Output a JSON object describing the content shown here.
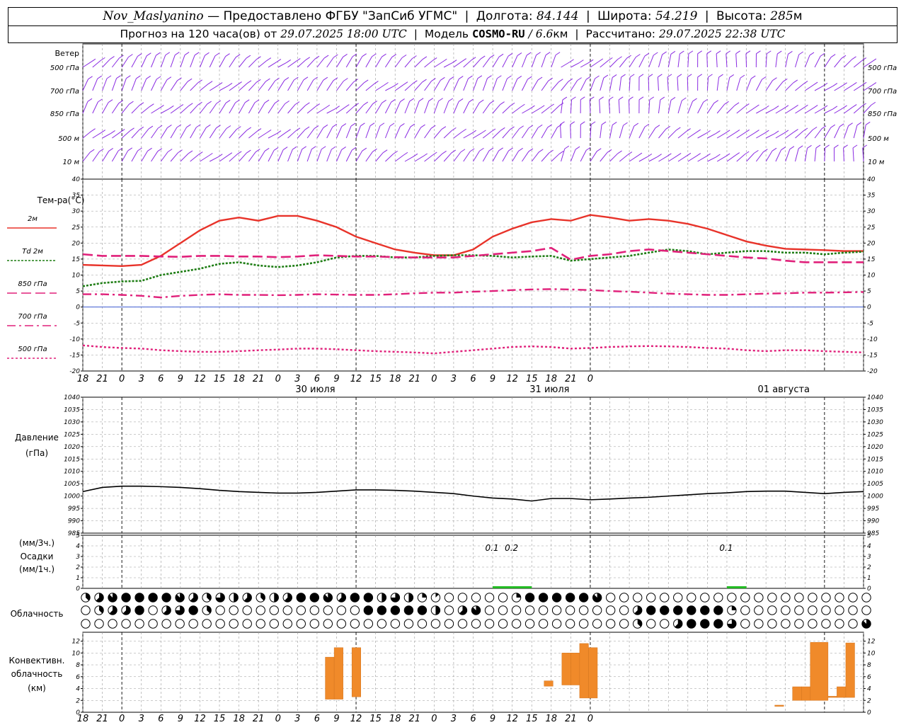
{
  "header": {
    "station": "Nov_Maslyanino",
    "provider": "— Предоставлено ФГБУ \"ЗапСиб УГМС\"",
    "lon_label": "Долгота:",
    "lon": "84.144",
    "lat_label": "Широта:",
    "lat": "54.219",
    "alt_label": "Высота:",
    "alt": "285",
    "alt_unit": "м",
    "forecast_label": "Прогноз на 120 часа(ов) от",
    "forecast_time": "29.07.2025 18:00 UTC",
    "model_label": "Модель",
    "model": "COSMO-RU",
    "resolution": "/ 6.6",
    "resolution_unit": "км",
    "calc_label": "Рассчитано:",
    "calc_time": "29.07.2025 22:38 UTC"
  },
  "colors": {
    "wind": "#8a2be2",
    "t2m": "#e8332a",
    "td2m": "#1e7d14",
    "t850": "#e0207a",
    "t700": "#e0207a",
    "t500": "#e0207a",
    "pressure": "#000000",
    "precip": "#22bb22",
    "convective": "#f08a2a",
    "grid": "#999999",
    "zero_line": "#2244cc"
  },
  "labels": {
    "wind_title": "Ветер",
    "wind_levels": [
      "500 гПа",
      "700 гПа",
      "850 гПа",
      "500 м",
      "10 м"
    ],
    "temp_title": "Тем-ра(°C)",
    "temp_legend": [
      "2м",
      "Td 2м",
      "850 гПа",
      "700 гПа",
      "500 гПа"
    ],
    "pressure_title": [
      "Давление",
      "(гПа)"
    ],
    "precip_title": [
      "(мм/3ч.)",
      "Осадки",
      "(мм/1ч.)"
    ],
    "cloud_title": "Облачность",
    "conv_title": [
      "Конвективн.",
      "облачность",
      "(км)"
    ],
    "hour_ticks": [
      "18",
      "21",
      "0",
      "3",
      "6",
      "9",
      "12",
      "15",
      "18",
      "21",
      "0",
      "3",
      "6",
      "9",
      "12",
      "15",
      "18",
      "21",
      "0",
      "3",
      "6",
      "9",
      "12",
      "15",
      "18",
      "21",
      "0"
    ],
    "dates": [
      "30 июля",
      "31 июля",
      "01 августа"
    ]
  },
  "chart_data": [
    {
      "type": "line",
      "panel": "temperature",
      "x_hours": [
        0,
        3,
        6,
        9,
        12,
        15,
        18,
        21,
        24,
        27,
        30,
        33,
        36,
        39,
        42,
        45,
        48,
        51,
        54,
        57,
        60,
        63,
        66,
        69,
        72,
        75,
        78,
        81,
        84,
        87,
        90,
        93,
        96,
        99,
        102,
        105,
        108,
        111,
        114,
        117,
        120
      ],
      "ylim": [
        -20,
        40
      ],
      "y_ticks": [
        -20,
        -15,
        -10,
        -5,
        0,
        5,
        10,
        15,
        20,
        25,
        30,
        35,
        40
      ],
      "series": [
        {
          "name": "2м",
          "values": [
            13.2,
            13,
            12.8,
            13.2,
            16,
            20,
            24,
            27,
            28,
            27,
            28.5,
            28.5,
            27,
            25,
            22,
            20,
            18,
            17,
            16.2,
            16.2,
            18,
            22,
            24.5,
            26.5,
            27.5,
            27,
            28.8,
            28,
            27,
            27.5,
            27,
            26,
            24.5,
            22.5,
            20.5,
            19.2,
            18.2,
            18,
            17.8,
            17.5,
            17.5
          ]
        },
        {
          "name": "Td 2м",
          "values": [
            6.5,
            7.5,
            8,
            8.2,
            10,
            11,
            12,
            13.5,
            14,
            13,
            12.5,
            13,
            14,
            15.5,
            16,
            16,
            15.5,
            15.5,
            16,
            16.2,
            16.2,
            16,
            15.5,
            15.8,
            16,
            14.5,
            15,
            15.5,
            16,
            17,
            18,
            17.5,
            16.5,
            17,
            17.5,
            17.5,
            17,
            17,
            16.5,
            17,
            17.3
          ]
        },
        {
          "name": "850 гПа",
          "values": [
            16.5,
            16,
            16,
            16,
            15.8,
            15.7,
            16,
            16,
            15.8,
            15.8,
            15.6,
            15.8,
            16.2,
            16,
            15.8,
            15.8,
            15.6,
            15.5,
            15.5,
            15.5,
            16,
            16.5,
            17,
            17.5,
            18.5,
            14.8,
            16,
            16.5,
            17.5,
            18,
            17.5,
            17,
            16.5,
            16,
            15.5,
            15.2,
            14.5,
            14,
            14,
            14,
            14
          ]
        },
        {
          "name": "700 гПа",
          "values": [
            4,
            4,
            3.8,
            3.5,
            3,
            3.5,
            3.8,
            4,
            3.8,
            3.8,
            3.7,
            3.8,
            4,
            3.9,
            3.8,
            3.8,
            4,
            4.3,
            4.5,
            4.5,
            4.8,
            5,
            5.3,
            5.5,
            5.6,
            5.5,
            5.3,
            5,
            4.8,
            4.5,
            4.2,
            4,
            3.8,
            3.8,
            4,
            4.2,
            4.3,
            4.5,
            4.5,
            4.6,
            4.7
          ]
        },
        {
          "name": "500 гПа",
          "values": [
            -12,
            -12.5,
            -12.8,
            -13,
            -13.5,
            -13.8,
            -14,
            -14,
            -13.8,
            -13.5,
            -13.3,
            -13,
            -13,
            -13.2,
            -13.5,
            -13.8,
            -14,
            -14.2,
            -14.5,
            -14,
            -13.5,
            -13,
            -12.5,
            -12.3,
            -12.5,
            -13,
            -12.8,
            -12.5,
            -12.3,
            -12.2,
            -12.3,
            -12.5,
            -12.8,
            -13,
            -13.5,
            -13.8,
            -13.5,
            -13.5,
            -13.8,
            -14,
            -14.2
          ]
        }
      ]
    },
    {
      "type": "line",
      "panel": "pressure",
      "x_hours": [
        0,
        3,
        6,
        9,
        12,
        15,
        18,
        21,
        24,
        27,
        30,
        33,
        36,
        39,
        42,
        45,
        48,
        51,
        54,
        57,
        60,
        63,
        66,
        69,
        72,
        75,
        78,
        81,
        84,
        87,
        90,
        93,
        96,
        99,
        102,
        105,
        108,
        111,
        114,
        117,
        120
      ],
      "ylim": [
        985,
        1040
      ],
      "y_ticks": [
        985,
        990,
        995,
        1000,
        1005,
        1010,
        1015,
        1020,
        1025,
        1030,
        1035,
        1040
      ],
      "series": [
        {
          "name": "Давление",
          "values": [
            1001.8,
            1003.5,
            1004,
            1004,
            1003.8,
            1003.5,
            1003,
            1002.3,
            1001.8,
            1001.5,
            1001.2,
            1001.2,
            1001.5,
            1002,
            1002.5,
            1002.5,
            1002.3,
            1002,
            1001.5,
            1001,
            1000,
            999.2,
            998.8,
            998,
            999,
            999,
            998.5,
            998.8,
            999.2,
            999.5,
            1000,
            1000.5,
            1001,
            1001.3,
            1001.8,
            1002,
            1002,
            1001.5,
            1001,
            1001.5,
            1001.8
          ]
        }
      ]
    },
    {
      "type": "bar",
      "panel": "precipitation",
      "ylim": [
        0,
        5
      ],
      "y_ticks": [
        0,
        1,
        2,
        3,
        4,
        5
      ],
      "bars": [
        {
          "x_hours": 63,
          "value": 0.1,
          "label": "0.1"
        },
        {
          "x_hours": 66,
          "value": 0.2,
          "label": "0.2"
        },
        {
          "x_hours": 99,
          "value": 0.1,
          "label": "0.1"
        }
      ]
    },
    {
      "type": "bar",
      "panel": "convective_cloud",
      "ylim": [
        0,
        12
      ],
      "y_ticks": [
        0,
        2,
        4,
        6,
        8,
        10,
        12
      ],
      "bars": [
        {
          "x_start": 41,
          "x_end": 42.5,
          "bottom": 2.2,
          "top": 9.3
        },
        {
          "x_start": 42.5,
          "x_end": 44,
          "bottom": 2.2,
          "top": 10.9
        },
        {
          "x_start": 45.5,
          "x_end": 47,
          "bottom": 2.6,
          "top": 10.9
        },
        {
          "x_start": 78,
          "x_end": 79.5,
          "bottom": 4.4,
          "top": 5.3
        },
        {
          "x_start": 81,
          "x_end": 82.5,
          "bottom": 4.6,
          "top": 10
        },
        {
          "x_start": 82.5,
          "x_end": 84,
          "bottom": 4.6,
          "top": 10
        },
        {
          "x_start": 84,
          "x_end": 85.5,
          "bottom": 2.4,
          "top": 11.6
        },
        {
          "x_start": 85.5,
          "x_end": 87,
          "bottom": 2.4,
          "top": 10.9
        },
        {
          "x_start": 117,
          "x_end": 118.5,
          "bottom": 1.0,
          "top": 1.2
        },
        {
          "x_start": 120,
          "x_end": 121.5,
          "bottom": 2.0,
          "top": 4.3
        },
        {
          "x_start": 121.5,
          "x_end": 123,
          "bottom": 2.0,
          "top": 4.3
        },
        {
          "x_start": 123,
          "x_end": 126,
          "bottom": 2.0,
          "top": 11.8
        },
        {
          "x_start": 126,
          "x_end": 127.5,
          "bottom": 2.5,
          "top": 2.7
        },
        {
          "x_start": 127.5,
          "x_end": 129,
          "bottom": 2.5,
          "top": 4.3
        },
        {
          "x_start": 129,
          "x_end": 130.5,
          "bottom": 2.5,
          "top": 11.7
        }
      ]
    },
    {
      "type": "table",
      "panel": "cloudiness",
      "note": "octas 0-8 per 3h, three layers (high, mid, low)",
      "rows": [
        [
          3,
          5,
          7,
          8,
          8,
          8,
          8,
          7,
          5,
          3,
          6,
          4,
          5,
          3,
          4,
          5,
          8,
          8,
          7,
          5,
          8,
          8,
          4,
          6,
          4,
          2,
          1,
          0,
          0,
          0,
          0,
          0,
          2,
          8,
          8,
          8,
          8,
          8,
          7,
          0,
          0,
          0,
          0,
          0,
          0,
          0,
          0,
          0,
          0,
          0,
          0,
          0,
          0,
          0,
          0,
          0,
          0,
          0,
          0
        ],
        [
          0,
          3,
          5,
          5,
          8,
          0,
          5,
          6,
          8,
          3,
          0,
          0,
          0,
          0,
          0,
          0,
          0,
          0,
          0,
          0,
          0,
          8,
          8,
          8,
          8,
          8,
          4,
          0,
          5,
          7,
          0,
          0,
          0,
          0,
          0,
          0,
          0,
          0,
          0,
          0,
          0,
          5,
          8,
          8,
          8,
          8,
          8,
          8,
          2,
          0,
          0,
          0,
          0,
          0,
          0,
          0,
          0,
          0,
          0
        ],
        [
          0,
          0,
          0,
          0,
          0,
          0,
          0,
          0,
          0,
          0,
          0,
          0,
          0,
          0,
          0,
          0,
          0,
          0,
          0,
          0,
          0,
          0,
          0,
          0,
          0,
          0,
          0,
          0,
          0,
          0,
          0,
          0,
          0,
          0,
          0,
          0,
          0,
          0,
          0,
          0,
          0,
          3,
          0,
          0,
          5,
          8,
          8,
          8,
          6,
          0,
          0,
          0,
          0,
          0,
          0,
          0,
          0,
          0,
          7
        ]
      ]
    },
    {
      "type": "barbs",
      "panel": "wind",
      "note": "wind barbs at 5 levels every 1.5h"
    }
  ]
}
